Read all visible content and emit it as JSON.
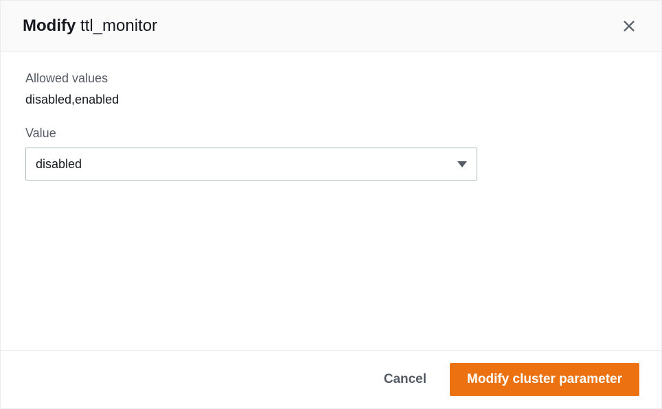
{
  "header": {
    "title_prefix": "Modify",
    "title_param": "ttl_monitor"
  },
  "body": {
    "allowed_values_label": "Allowed values",
    "allowed_values": "disabled,enabled",
    "value_label": "Value",
    "selected_value": "disabled"
  },
  "footer": {
    "cancel_label": "Cancel",
    "submit_label": "Modify cluster parameter"
  }
}
